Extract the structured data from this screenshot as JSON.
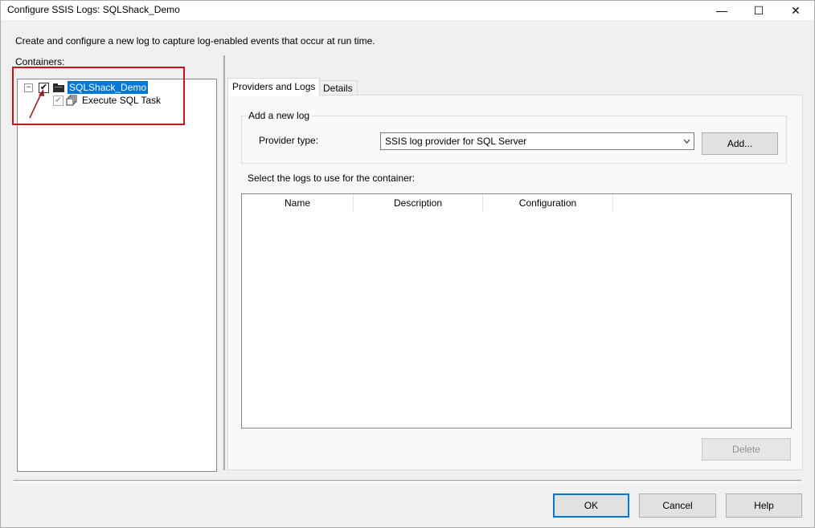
{
  "window": {
    "title": "Configure SSIS Logs: SQLShack_Demo",
    "minimize": "—",
    "maximize": "☐",
    "close": "✕"
  },
  "intro_text": "Create and configure a new log to capture log-enabled events that occur at run time.",
  "containers": {
    "label": "Containers:",
    "root": {
      "expander": "−",
      "checkbox": "✔",
      "label": "SQLShack_Demo"
    },
    "child": {
      "checkbox": "✔",
      "label": "Execute SQL Task"
    }
  },
  "tabs": [
    {
      "label": "Providers and Logs"
    },
    {
      "label": "Details"
    }
  ],
  "add_log": {
    "group_title": "Add a new log",
    "provider_label": "Provider type:",
    "provider_value": "SSIS log provider for SQL Server",
    "add_button": "Add..."
  },
  "logs": {
    "label": "Select the logs to use for the container:",
    "columns": [
      "Name",
      "Description",
      "Configuration"
    ],
    "delete_button": "Delete"
  },
  "dialog_buttons": {
    "ok": "OK",
    "cancel": "Cancel",
    "help": "Help"
  },
  "colors": {
    "selection": "#0078d7",
    "annotation": "#c4131d"
  },
  "icons": {
    "container": "package-icon",
    "task": "execute-sql-task-icon",
    "dropdown": "chevron-down-icon"
  }
}
